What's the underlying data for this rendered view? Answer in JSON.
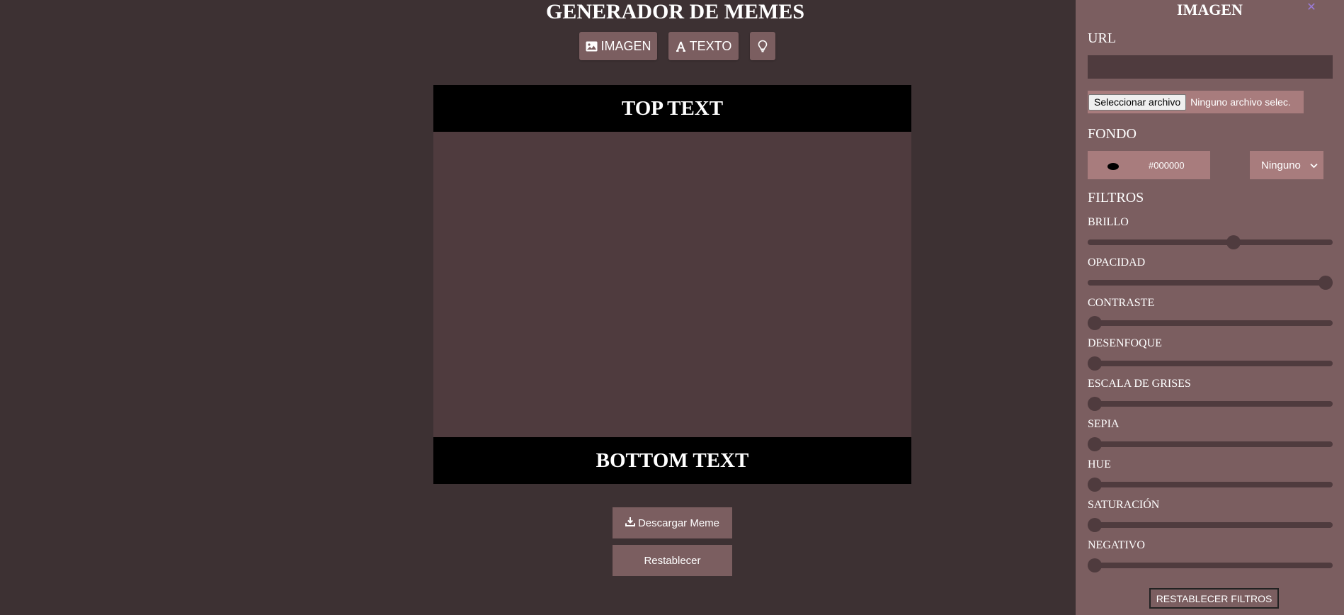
{
  "app": {
    "title": "GENERADOR DE MEMES"
  },
  "nav": {
    "imagen_label": "IMAGEN",
    "texto_label": "TEXTO",
    "mode_icon": "lightbulb-icon"
  },
  "meme": {
    "top_text": "TOP TEXT",
    "bottom_text": "BOTTOM TEXT"
  },
  "actions": {
    "download_label": "Descargar Meme",
    "reset_label": "Restablecer"
  },
  "panel": {
    "title": "IMAGEN",
    "close_icon": "close-icon",
    "url_label": "URL",
    "url_value": "",
    "file_button_label": "Seleccionar archivo",
    "file_status": "Ninguno archivo selec.",
    "fondo_label": "FONDO",
    "color_value": "#000000",
    "blend_mode": "Ninguno",
    "filtros_label": "FILTROS",
    "filters": [
      {
        "label": "BRILLO",
        "value": 0.6
      },
      {
        "label": "OPACIDAD",
        "value": 1.0
      },
      {
        "label": "CONTRASTE",
        "value": 0
      },
      {
        "label": "DESENFOQUE",
        "value": 0
      },
      {
        "label": "ESCALA DE GRISES",
        "value": 0
      },
      {
        "label": "SEPIA",
        "value": 0
      },
      {
        "label": "HUE",
        "value": 0
      },
      {
        "label": "SATURACIÓN",
        "value": 0
      },
      {
        "label": "NEGATIVO",
        "value": 0
      }
    ],
    "reset_filters_label": "RESTABLECER FILTROS"
  },
  "colors": {
    "background": "#3d3133",
    "panel": "#7b5e60",
    "button": "#7b5e60",
    "image_area": "#4f3b3e",
    "input_accent": "#a87c7d",
    "close_icon": "#9b7bd8"
  }
}
